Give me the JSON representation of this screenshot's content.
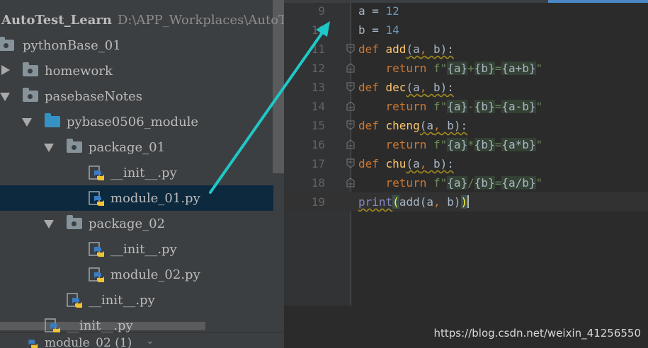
{
  "project_tree": {
    "root": {
      "name": "AutoTest_Learn",
      "path": "D:\\APP_Workplaces\\AutoTe"
    },
    "items": [
      {
        "label": "pythonBase_01",
        "type": "folder"
      },
      {
        "label": "homework",
        "type": "folder",
        "expanded": false
      },
      {
        "label": "pasebaseNotes",
        "type": "folder",
        "expanded": true
      },
      {
        "label": "pybase0506_module",
        "type": "folder",
        "expanded": true
      },
      {
        "label": "package_01",
        "type": "package",
        "expanded": true
      },
      {
        "label": "__init__.py",
        "type": "python-file"
      },
      {
        "label": "module_01.py",
        "type": "python-file",
        "selected": true
      },
      {
        "label": "package_02",
        "type": "package",
        "expanded": true
      },
      {
        "label": "__init__.py",
        "type": "python-file"
      },
      {
        "label": "module_02.py",
        "type": "python-file"
      },
      {
        "label": "__init__.py",
        "type": "python-file"
      },
      {
        "label": "__init__.py",
        "type": "python-file"
      }
    ],
    "bottom_tab": "module_02 (1)"
  },
  "editor": {
    "lines": [
      {
        "n": "9",
        "tokens": [
          [
            "plain",
            "a = "
          ],
          [
            "num",
            "12"
          ]
        ]
      },
      {
        "n": "10",
        "tokens": [
          [
            "plain",
            "b = "
          ],
          [
            "num",
            "14"
          ]
        ]
      },
      {
        "n": "11",
        "tokens": [
          [
            "kw",
            "def "
          ],
          [
            "fn",
            "add"
          ],
          [
            "plain",
            "(a"
          ],
          [
            "kw",
            ","
          ],
          [
            "plain",
            " b):"
          ]
        ]
      },
      {
        "n": "12",
        "tokens": [
          [
            "plain",
            "    "
          ],
          [
            "kw",
            "return "
          ],
          [
            "str",
            "f\""
          ],
          [
            "brace",
            "{a}"
          ],
          [
            "str",
            "+"
          ],
          [
            "brace",
            "{b}"
          ],
          [
            "str",
            "="
          ],
          [
            "brace",
            "{a+b}"
          ],
          [
            "str",
            "\""
          ]
        ]
      },
      {
        "n": "13",
        "tokens": [
          [
            "kw",
            "def "
          ],
          [
            "fn",
            "dec"
          ],
          [
            "plain",
            "(a"
          ],
          [
            "kw",
            ","
          ],
          [
            "plain",
            " b):"
          ]
        ]
      },
      {
        "n": "14",
        "tokens": [
          [
            "plain",
            "    "
          ],
          [
            "kw",
            "return "
          ],
          [
            "str",
            "f\""
          ],
          [
            "brace",
            "{a}"
          ],
          [
            "str",
            "-"
          ],
          [
            "brace",
            "{b}"
          ],
          [
            "str",
            "="
          ],
          [
            "brace",
            "{a-b}"
          ],
          [
            "str",
            "\""
          ]
        ]
      },
      {
        "n": "15",
        "tokens": [
          [
            "kw",
            "def "
          ],
          [
            "fn",
            "cheng"
          ],
          [
            "plain",
            "(a"
          ],
          [
            "kw",
            ","
          ],
          [
            "plain",
            " b):"
          ]
        ]
      },
      {
        "n": "16",
        "tokens": [
          [
            "plain",
            "    "
          ],
          [
            "kw",
            "return "
          ],
          [
            "str",
            "f\""
          ],
          [
            "brace",
            "{a}"
          ],
          [
            "str",
            "*"
          ],
          [
            "brace",
            "{b}"
          ],
          [
            "str",
            "="
          ],
          [
            "brace",
            "{a*b}"
          ],
          [
            "str",
            "\""
          ]
        ]
      },
      {
        "n": "17",
        "tokens": [
          [
            "kw",
            "def "
          ],
          [
            "fn",
            "chu"
          ],
          [
            "plain",
            "(a"
          ],
          [
            "kw",
            ","
          ],
          [
            "plain",
            " b):"
          ]
        ]
      },
      {
        "n": "18",
        "tokens": [
          [
            "plain",
            "    "
          ],
          [
            "kw",
            "return "
          ],
          [
            "str",
            "f\""
          ],
          [
            "brace",
            "{a}"
          ],
          [
            "str",
            "/"
          ],
          [
            "brace",
            "{b}"
          ],
          [
            "str",
            "="
          ],
          [
            "brace",
            "{a/b}"
          ],
          [
            "str",
            "\""
          ]
        ]
      },
      {
        "n": "19",
        "tokens": [
          [
            "builtin",
            "print"
          ],
          [
            "paren",
            "("
          ],
          [
            "plain",
            "add(a"
          ],
          [
            "kw",
            ","
          ],
          [
            "plain",
            " b)"
          ],
          [
            "paren",
            ")"
          ]
        ]
      }
    ]
  },
  "watermark": "https://blog.csdn.net/weixin_41256550",
  "colors": {
    "accent_arrow": "#1fc8c8",
    "selection": "#0d293e"
  }
}
